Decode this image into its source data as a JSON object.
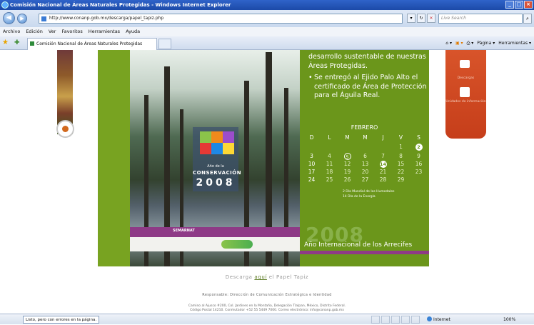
{
  "window": {
    "title": "Comisión Nacional de Áreas Naturales Protegidas - Windows Internet Explorer"
  },
  "address_bar": {
    "url": "http://www.conanp.gob.mx/descarga/papel_tapiz.php",
    "search_placeholder": "Live Search"
  },
  "menu": [
    "Archivo",
    "Edición",
    "Ver",
    "Favoritos",
    "Herramientas",
    "Ayuda"
  ],
  "tab": {
    "title": "Comisión Nacional de Áreas Naturales Protegidas"
  },
  "command_bar": {
    "page": "Página",
    "tools": "Herramientas"
  },
  "wallpaper": {
    "news": [
      "desarrollo sustentable de nuestras Áreas Protegidas.",
      "Se entregó al Ejido Palo Alto el certificado de Área de Protección para el Águila Real."
    ],
    "logo_small": "Año de la",
    "logo_title": "CONSERVACIÓN",
    "logo_year": "2008",
    "semarnat": "SEMARNAT",
    "calendar": {
      "month": "FEBRERO",
      "weekdays": [
        "D",
        "L",
        "M",
        "M",
        "J",
        "V",
        "S"
      ],
      "weeks": [
        [
          "",
          "",
          "",
          "",
          "",
          "1",
          "2"
        ],
        [
          "3",
          "4",
          "5",
          "6",
          "7",
          "8",
          "9"
        ],
        [
          "10",
          "11",
          "12",
          "13",
          "14",
          "15",
          "16"
        ],
        [
          "17",
          "18",
          "19",
          "20",
          "21",
          "22",
          "23"
        ],
        [
          "24",
          "25",
          "26",
          "27",
          "28",
          "29",
          ""
        ]
      ]
    },
    "events": [
      "2  Día Mundial de los Humedales",
      "14  Día de la Energía"
    ],
    "year_big": "2008",
    "year_caption": "Año Internacional de los Arrecifes"
  },
  "side_links": {
    "item1": "Descargas",
    "item2": "Unidades de información"
  },
  "footer": {
    "download_prefix": "Descarga",
    "download_link": "aquí",
    "download_suffix": "el Papel Tapiz",
    "responsable": "Responsable: Dirección de Comunicación Estratégica e Identidad",
    "address_line1": "Camino al Ajusco #200, Col. Jardines en la Montaña, Delegación Tlalpan, México, Distrito Federal.",
    "address_line2": "Código Postal 14210. Conmutador +52 55 5449 7000. Correo electrónico: info@conanp.gob.mx"
  },
  "status_bar": {
    "status_text": "Listo, pero con errores en la página.",
    "zone": "Internet",
    "zoom": "100%"
  }
}
